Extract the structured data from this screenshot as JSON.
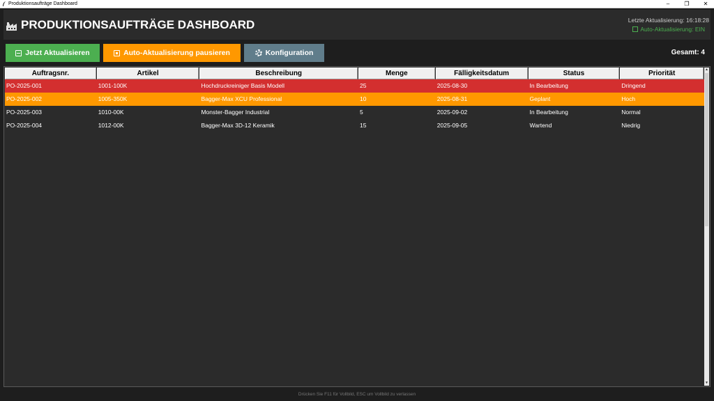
{
  "window": {
    "title": "Produktionsaufträge Dashboard",
    "controls": {
      "minimize": "–",
      "maximize": "❐",
      "close": "✕"
    }
  },
  "header": {
    "title": "PRODUKTIONSAUFTRÄGE DASHBOARD",
    "last_update": "Letzte Aktualisierung: 16:18:28",
    "auto_refresh": "Auto-Aktualisierung: EIN",
    "icon": "factory-icon"
  },
  "toolbar": {
    "refresh_label": "Jetzt Aktualisieren",
    "pause_label": "Auto-Aktualisierung pausieren",
    "config_label": "Konfiguration",
    "total": "Gesamt: 4"
  },
  "table": {
    "columns": [
      "Auftragsnr.",
      "Artikel",
      "Beschreibung",
      "Menge",
      "Fälligkeitsdatum",
      "Status",
      "Priorität"
    ],
    "rows": [
      [
        "PO-2025-001",
        "1001-100K",
        "Hochdruckreiniger Basis Modell",
        "25",
        "2025-08-30",
        "In Bearbeitung",
        "Dringend"
      ],
      [
        "PO-2025-002",
        "1005-350K",
        "Bagger-Max XCU Professional",
        "10",
        "2025-08-31",
        "Geplant",
        "Hoch"
      ],
      [
        "PO-2025-003",
        "1010-00K",
        "Monster-Bagger Industrial",
        "5",
        "2025-09-02",
        "In Bearbeitung",
        "Normal"
      ],
      [
        "PO-2025-004",
        "1012-00K",
        "Bagger-Max 3D-12 Keramik",
        "15",
        "2025-09-05",
        "Wartend",
        "Niedrig"
      ]
    ]
  },
  "colors": {
    "urgent": "#d32f2f",
    "high": "#ff9800",
    "refresh_button": "#4caf50",
    "pause_button": "#ff9800",
    "config_button": "#607d8b"
  },
  "footer": {
    "hint": "Drücken Sie F11 für Vollbild, ESC um Vollbild zu verlassen"
  }
}
